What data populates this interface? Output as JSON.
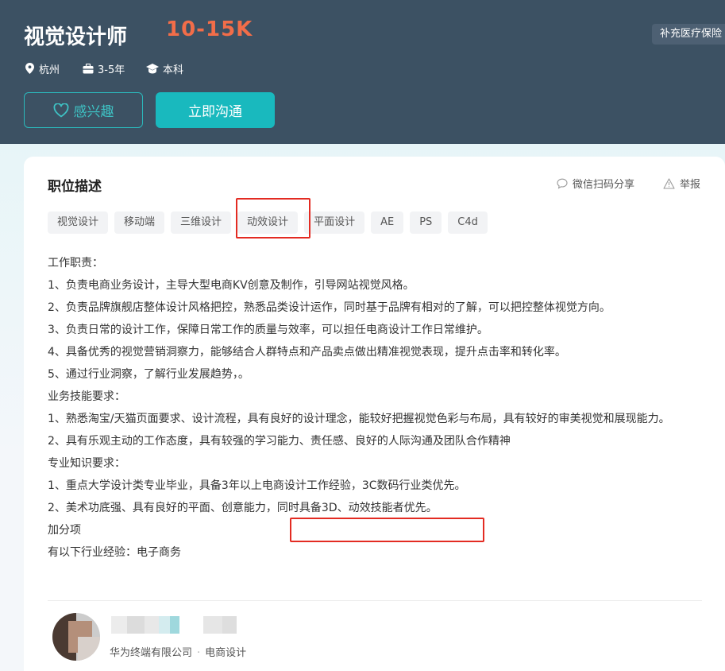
{
  "header": {
    "job_title": "视觉设计师",
    "salary": "10-15K",
    "benefit": "补充医疗保险",
    "city": "杭州",
    "experience": "3-5年",
    "education": "本科",
    "interest_button": "感兴趣",
    "chat_button": "立即沟通"
  },
  "card": {
    "title": "职位描述",
    "share": "微信扫码分享",
    "report": "举报",
    "tags": [
      "视觉设计",
      "移动端",
      "三维设计",
      "动效设计",
      "平面设计",
      "AE",
      "PS",
      "C4d"
    ],
    "description": [
      "工作职责：",
      "1、负责电商业务设计，主导大型电商KV创意及制作，引导网站视觉风格。",
      "2、负责品牌旗舰店整体设计风格把控，熟悉品类设计运作，同时基于品牌有相对的了解，可以把控整体视觉方向。",
      "3、负责日常的设计工作，保障日常工作的质量与效率，可以担任电商设计工作日常维护。",
      "4、具备优秀的视觉营销洞察力，能够结合人群特点和产品卖点做出精准视觉表现，提升点击率和转化率。",
      "5、通过行业洞察，了解行业发展趋势，。",
      "业务技能要求：",
      "1、熟悉淘宝/天猫页面要求、设计流程，具有良好的设计理念，能较好把握视觉色彩与布局，具有较好的审美视觉和展现能力。",
      "2、具有乐观主动的工作态度，具有较强的学习能力、责任感、良好的人际沟通及团队合作精神",
      "专业知识要求：",
      "1、重点大学设计类专业毕业，具备3年以上电商设计工作经验，3C数码行业类优先。",
      "2、美术功底强、具有良好的平面、创意能力，同时具备3D、动效技能者优先。",
      "加分项",
      "有以下行业经验：电子商务"
    ]
  },
  "recruiter": {
    "company": "华为终端有限公司",
    "role": "电商设计"
  }
}
